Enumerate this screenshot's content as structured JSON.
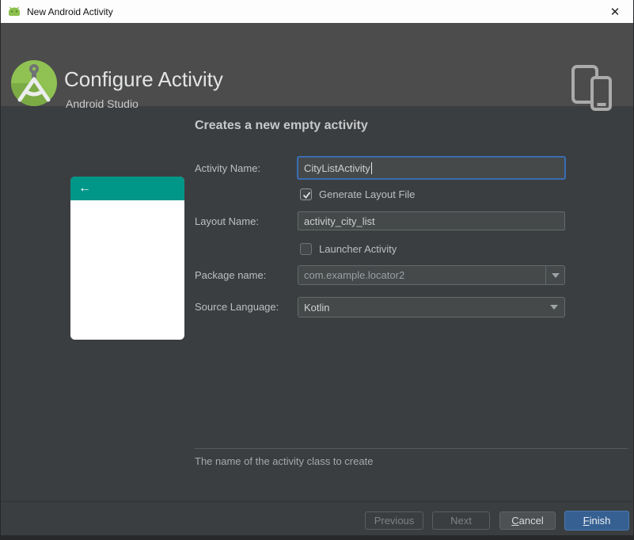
{
  "titlebar": {
    "title": "New Android Activity",
    "close_glyph": "✕"
  },
  "header": {
    "title": "Configure Activity",
    "subtitle": "Android Studio"
  },
  "main": {
    "heading": "Creates a new empty activity",
    "preview": {
      "back_arrow_glyph": "←",
      "accent_color": "#009688"
    },
    "fields": {
      "activity_name": {
        "label": "Activity Name:",
        "value": "CityListActivity",
        "focused": true
      },
      "generate_layout": {
        "label": "Generate Layout File",
        "checked": true
      },
      "layout_name": {
        "label": "Layout Name:",
        "value": "activity_city_list"
      },
      "launcher_activity": {
        "label": "Launcher Activity",
        "checked": false
      },
      "package_name": {
        "label": "Package name:",
        "value": "com.example.locator2"
      },
      "source_language": {
        "label": "Source Language:",
        "value": "Kotlin"
      }
    },
    "hint": "The name of the activity class to create"
  },
  "footer": {
    "buttons": {
      "previous": {
        "label": "Previous",
        "enabled": false
      },
      "next": {
        "label": "Next",
        "enabled": false
      },
      "cancel": {
        "label": "Cancel",
        "enabled": true
      },
      "finish": {
        "label": "Finish",
        "enabled": true,
        "primary": true
      }
    }
  },
  "colors": {
    "titlebar_bg": "#fdfdfd",
    "header_bg": "#4c4c4c",
    "panel_bg": "#3b3e40",
    "field_bg": "#45494a",
    "focus_border": "#3a6db4",
    "accent_teal": "#009688",
    "primary_button": "#366092",
    "android_green": "#8dc04e"
  },
  "icons": {
    "titlebar_app": "android-head-icon",
    "header_logo": "android-studio-logo",
    "header_right": "phone-tablet-icon"
  }
}
